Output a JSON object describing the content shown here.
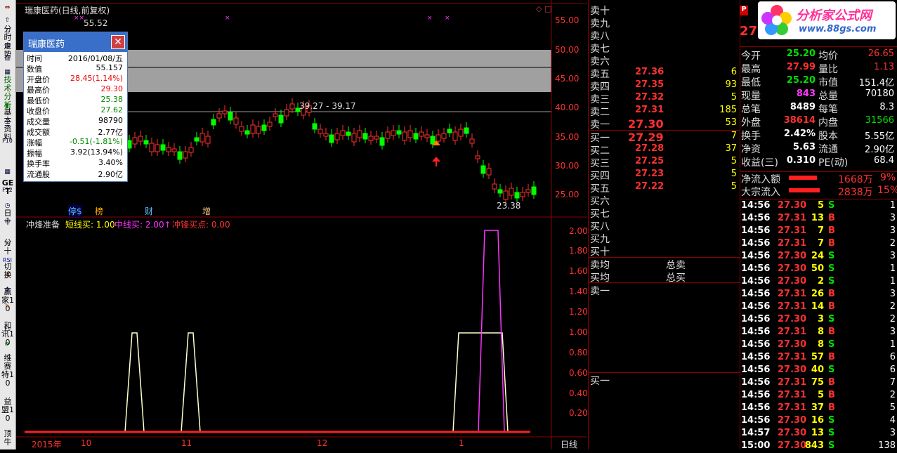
{
  "chart": {
    "title": "瑞康医药(日线,前复权)",
    "top_marker": "55.52",
    "range_label": "39.27 - 39.17",
    "low_marker": "23.38",
    "y_ticks": [
      "55.00",
      "50.00",
      "45.00",
      "40.00",
      "35.00",
      "30.00",
      "25.00"
    ],
    "badges": [
      "停$",
      "榜",
      "财",
      "增"
    ],
    "indicator": {
      "name": "冲烽准备",
      "short_buy": "短线买: 1.00",
      "mid_buy": "中线买: 2.00↑",
      "rush_buy": "冲锋买点: 0.00",
      "y_ticks": [
        "2.00",
        "1.80",
        "1.60",
        "1.40",
        "1.20",
        "1.00",
        "0.80",
        "0.60",
        "0.40",
        "0.20"
      ]
    },
    "x_labels": [
      "2015年",
      "10",
      "11",
      "12",
      "1"
    ],
    "period": "日线"
  },
  "popup": {
    "title": "瑞康医药",
    "rows": [
      {
        "k": "时间",
        "v": "2016/01/08/五"
      },
      {
        "k": "数值",
        "v": "55.157"
      },
      {
        "k": "开盘价",
        "v": "28.45(1.14%)"
      },
      {
        "k": "最高价",
        "v": "29.30"
      },
      {
        "k": "最低价",
        "v": "25.38"
      },
      {
        "k": "收盘价",
        "v": "27.62"
      },
      {
        "k": "成交量",
        "v": "98790"
      },
      {
        "k": "成交额",
        "v": "2.77亿"
      },
      {
        "k": "涨幅",
        "v": "-0.51(-1.81%)"
      },
      {
        "k": "振幅",
        "v": "3.92(13.94%)"
      },
      {
        "k": "换手率",
        "v": "3.40%"
      },
      {
        "k": "流通股",
        "v": "2.90亿"
      }
    ]
  },
  "toolbar": {
    "items": [
      "分时走势",
      "技术分析",
      "基本资料",
      "Fl0",
      "Fl2",
      "GET",
      "日十",
      "分十",
      "切换",
      "赢家10",
      "和讯10",
      "维赛特10",
      "益盟10",
      "顶牛"
    ]
  },
  "orderbook": {
    "sells": [
      {
        "label": "卖十",
        "price": "",
        "vol": ""
      },
      {
        "label": "卖九",
        "price": "",
        "vol": ""
      },
      {
        "label": "卖八",
        "price": "",
        "vol": ""
      },
      {
        "label": "卖七",
        "price": "",
        "vol": ""
      },
      {
        "label": "卖六",
        "price": "",
        "vol": ""
      },
      {
        "label": "卖五",
        "price": "27.36",
        "vol": "6"
      },
      {
        "label": "卖四",
        "price": "27.35",
        "vol": "93"
      },
      {
        "label": "卖三",
        "price": "27.32",
        "vol": "5"
      },
      {
        "label": "卖二",
        "price": "27.31",
        "vol": "185"
      },
      {
        "label": "卖一",
        "price": "27.30",
        "vol": "53"
      }
    ],
    "buys": [
      {
        "label": "买一",
        "price": "27.29",
        "vol": "7"
      },
      {
        "label": "买二",
        "price": "27.28",
        "vol": "37"
      },
      {
        "label": "买三",
        "price": "27.25",
        "vol": "5"
      },
      {
        "label": "买四",
        "price": "27.23",
        "vol": "5"
      },
      {
        "label": "买五",
        "price": "27.22",
        "vol": "5"
      },
      {
        "label": "买六",
        "price": "",
        "vol": ""
      },
      {
        "label": "买七",
        "price": "",
        "vol": ""
      },
      {
        "label": "买八",
        "price": "",
        "vol": ""
      },
      {
        "label": "买九",
        "price": "",
        "vol": ""
      },
      {
        "label": "买十",
        "price": "",
        "vol": ""
      }
    ],
    "avg_sell": "卖均",
    "avg_buy": "买均",
    "total_sell": "总卖",
    "total_buy": "总买",
    "queue_sell": "卖一",
    "queue_buy": "买一"
  },
  "quote": {
    "logo_text": "分析家公式网",
    "logo_url": "www.88gs.com",
    "price_short": "27",
    "rows": [
      {
        "k1": "今开",
        "v1": "25.20",
        "k2": "均价",
        "v2": "26.65"
      },
      {
        "k1": "最高",
        "v1": "27.99",
        "k2": "量比",
        "v2": "1.13"
      },
      {
        "k1": "最低",
        "v1": "25.20",
        "k2": "市值",
        "v2": "151.4亿"
      },
      {
        "k1": "现量",
        "v1": "843",
        "k2": "总量",
        "v2": "70180"
      },
      {
        "k1": "总笔",
        "v1": "8489",
        "k2": "每笔",
        "v2": "8.3"
      },
      {
        "k1": "外盘",
        "v1": "38614",
        "k2": "内盘",
        "v2": "31566"
      },
      {
        "k1": "换手",
        "v1": "2.42%",
        "k2": "股本",
        "v2": "5.55亿"
      },
      {
        "k1": "净资",
        "v1": "5.63",
        "k2": "流通",
        "v2": "2.90亿"
      },
      {
        "k1": "收益(三)",
        "v1": "0.310",
        "k2": "PE(动)",
        "v2": "68.4"
      }
    ],
    "net_inflow_label": "净流入额",
    "net_inflow_value": "1668万",
    "net_inflow_pct": "9%",
    "block_inflow_label": "大宗流入",
    "block_inflow_value": "2838万",
    "block_inflow_pct": "15%"
  },
  "ticks": [
    {
      "t": "14:56",
      "p": "27.30",
      "v": "5",
      "s": "S",
      "n": "1"
    },
    {
      "t": "14:56",
      "p": "27.31",
      "v": "13",
      "s": "B",
      "n": "3"
    },
    {
      "t": "14:56",
      "p": "27.31",
      "v": "7",
      "s": "B",
      "n": "3"
    },
    {
      "t": "14:56",
      "p": "27.31",
      "v": "7",
      "s": "B",
      "n": "2"
    },
    {
      "t": "14:56",
      "p": "27.30",
      "v": "24",
      "s": "S",
      "n": "3"
    },
    {
      "t": "14:56",
      "p": "27.30",
      "v": "50",
      "s": "S",
      "n": "1"
    },
    {
      "t": "14:56",
      "p": "27.30",
      "v": "2",
      "s": "S",
      "n": "1"
    },
    {
      "t": "14:56",
      "p": "27.31",
      "v": "26",
      "s": "B",
      "n": "3"
    },
    {
      "t": "14:56",
      "p": "27.31",
      "v": "14",
      "s": "B",
      "n": "2"
    },
    {
      "t": "14:56",
      "p": "27.30",
      "v": "3",
      "s": "S",
      "n": "2"
    },
    {
      "t": "14:56",
      "p": "27.31",
      "v": "8",
      "s": "B",
      "n": "3"
    },
    {
      "t": "14:56",
      "p": "27.30",
      "v": "8",
      "s": "S",
      "n": "1"
    },
    {
      "t": "14:56",
      "p": "27.31",
      "v": "57",
      "s": "B",
      "n": "6"
    },
    {
      "t": "14:56",
      "p": "27.30",
      "v": "40",
      "s": "S",
      "n": "6"
    },
    {
      "t": "14:56",
      "p": "27.31",
      "v": "75",
      "s": "B",
      "n": "7"
    },
    {
      "t": "14:56",
      "p": "27.31",
      "v": "5",
      "s": "B",
      "n": "2"
    },
    {
      "t": "14:56",
      "p": "27.31",
      "v": "37",
      "s": "B",
      "n": "5"
    },
    {
      "t": "14:56",
      "p": "27.30",
      "v": "16",
      "s": "S",
      "n": "4"
    },
    {
      "t": "14:57",
      "p": "27.30",
      "v": "13",
      "s": "S",
      "n": "3"
    },
    {
      "t": "15:00",
      "p": "27.30",
      "v": "843",
      "s": "S",
      "n": "138"
    }
  ],
  "colors": {
    "up": "#ff3030",
    "down": "#00ff00",
    "grid": "#8b0000",
    "yellow": "#ffff00",
    "magenta": "#ff33ff"
  }
}
